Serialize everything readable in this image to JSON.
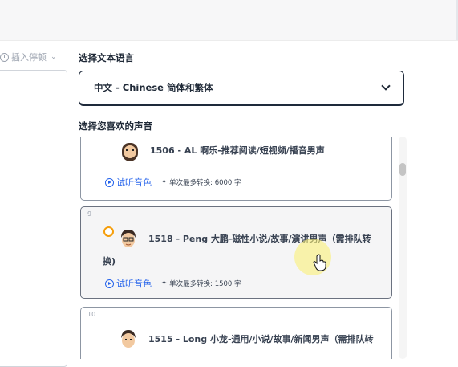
{
  "toolbar": {
    "insert_pause": "插入停顿"
  },
  "language": {
    "label": "选择文本语言",
    "selected": "中文 - Chinese 简体和繁体"
  },
  "voices": {
    "label": "选择您喜欢的声音",
    "items": [
      {
        "name": "1506 - AL 啊乐-推荐阅读/短视频/播音男声",
        "preview": "试听音色",
        "limit": "单次最多转换: 6000 字",
        "index": "",
        "selected": false
      },
      {
        "name": "1518 - Peng 大鹏-磁性小说/故事/演讲男声（需排队转",
        "name_wrap": "换)",
        "preview": "试听音色",
        "limit": "单次最多转换: 1500 字",
        "index": "9",
        "selected": true
      },
      {
        "name": "1515 - Long 小龙-通用/小说/故事/新闻男声（需排队转",
        "index": "10",
        "selected": false
      }
    ]
  },
  "colors": {
    "accent": "#2563eb",
    "radio": "#f59e0b",
    "border": "#1e2a3b"
  }
}
